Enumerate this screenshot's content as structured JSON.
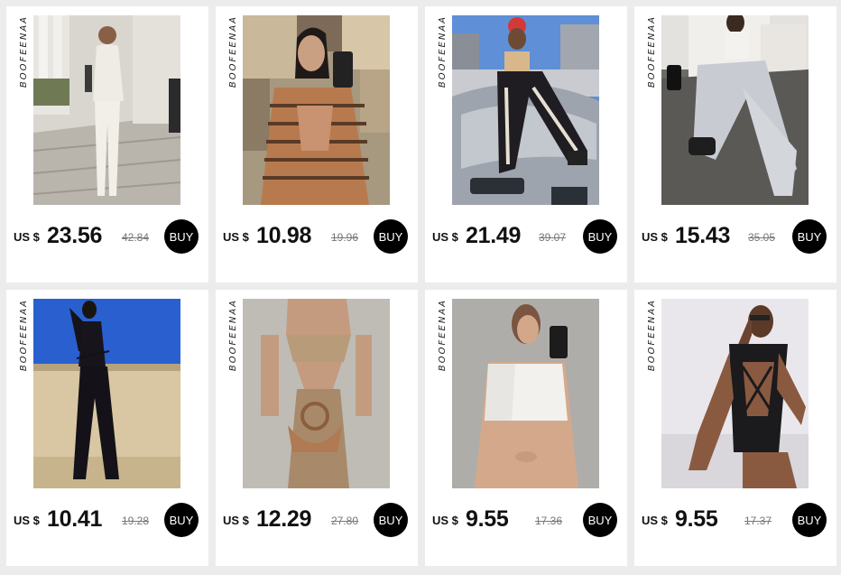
{
  "products": [
    {
      "brand": "BOOFEENAA",
      "currency": "US $",
      "price": "23.56",
      "old_price": "42.84",
      "buy_label": "BUY",
      "photo_icon": "model-white-cardigan-set"
    },
    {
      "brand": "BOOFEENAA",
      "currency": "US $",
      "price": "10.98",
      "old_price": "19.96",
      "buy_label": "BUY",
      "photo_icon": "model-striped-cutout-top"
    },
    {
      "brand": "BOOFEENAA",
      "currency": "US $",
      "price": "21.49",
      "old_price": "39.07",
      "buy_label": "BUY",
      "photo_icon": "model-skeleton-pants-on-car"
    },
    {
      "brand": "BOOFEENAA",
      "currency": "US $",
      "price": "15.43",
      "old_price": "35.05",
      "buy_label": "BUY",
      "photo_icon": "model-grey-sweatpants"
    },
    {
      "brand": "BOOFEENAA",
      "currency": "US $",
      "price": "10.41",
      "old_price": "19.28",
      "buy_label": "BUY",
      "photo_icon": "model-black-flare-jumpsuit"
    },
    {
      "brand": "BOOFEENAA",
      "currency": "US $",
      "price": "12.29",
      "old_price": "27.80",
      "buy_label": "BUY",
      "photo_icon": "model-knit-cutout-dress"
    },
    {
      "brand": "BOOFEENAA",
      "currency": "US $",
      "price": "9.55",
      "old_price": "17.36",
      "buy_label": "BUY",
      "photo_icon": "model-white-crop-tank"
    },
    {
      "brand": "BOOFEENAA",
      "currency": "US $",
      "price": "9.55",
      "old_price": "17.37",
      "buy_label": "BUY",
      "photo_icon": "model-black-lace-up-bodysuit"
    }
  ],
  "colors": {
    "background": "#ececec",
    "card": "#ffffff",
    "buy_button": "#000000",
    "old_price": "#777777"
  }
}
